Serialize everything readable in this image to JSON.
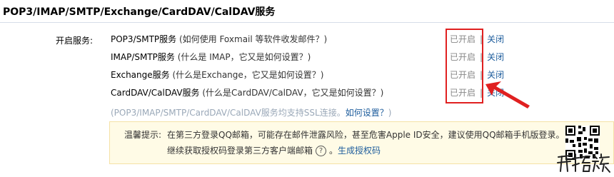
{
  "header": {
    "title": "POP3/IMAP/SMTP/Exchange/CardDAV/CalDAV服务"
  },
  "services": {
    "label": "开启服务:",
    "rows": [
      {
        "name": "POP3/SMTP服务",
        "hint": " (如何使用 Foxmail 等软件收发邮件？)",
        "on": "已开启",
        "sep": "|",
        "off": "关闭"
      },
      {
        "name": "IMAP/SMTP服务",
        "hint": " (什么是 IMAP，它又是如何设置？)",
        "on": "已开启",
        "sep": "|",
        "off": "关闭"
      },
      {
        "name": "Exchange服务",
        "hint": " (什么是Exchange，它又是如何设置？)",
        "on": "已开启",
        "sep": "|",
        "off": "关闭"
      },
      {
        "name": "CardDAV/CalDAV服务",
        "hint": " (什么是CardDAV/CalDAV，它又是如何设置？)",
        "on": "已开启",
        "sep": "|",
        "off": "关闭"
      }
    ],
    "ssl_note": "(POP3/IMAP/SMTP/CardDAV/CalDAV服务均支持SSL连接。",
    "ssl_how": "如何设置？",
    "ssl_close": ")"
  },
  "tip": {
    "label": "温馨提示:",
    "line1": "在第三方登录QQ邮箱，可能存在邮件泄露风险，甚至危害Apple ID安全，建议使用QQ邮箱手机版登录。",
    "line2_pre": "继续获取授权码登录第三方客户端邮箱",
    "q": "?",
    "line2_dot": "。",
    "generate": "生成授权码"
  },
  "colors": {
    "highlight_red": "#e02020",
    "link_blue": "#1d5c9c",
    "tip_bg": "#fffbe6"
  },
  "watermark": {
    "text": "开拓族"
  }
}
